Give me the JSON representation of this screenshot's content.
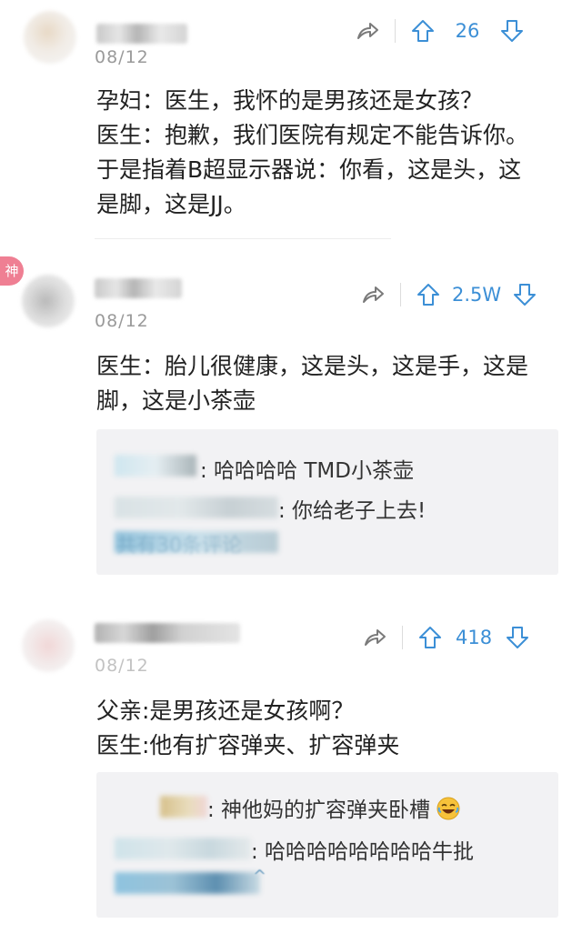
{
  "posts": [
    {
      "date": "08/12",
      "count": "26",
      "lines": [
        "孕妇：医生，我怀的是男孩还是女孩？",
        "医生：抱歉，我们医院有规定不能告诉你。",
        "于是指着B超显示器说：你看，这是头，这",
        "是脚，这是JJ。"
      ]
    },
    {
      "badge": "神",
      "date": "08/12",
      "count": "2.5W",
      "lines": [
        "医生：胎儿很健康，这是头，这是手，这是",
        "脚，这是小茶壶"
      ],
      "replies": [
        {
          "text": ": 哈哈哈哈 TMD小茶壶"
        },
        {
          "text": ": 你给老子上去!"
        }
      ],
      "more": "共有30条评论"
    },
    {
      "date": "08/12",
      "count": "418",
      "lines": [
        "父亲:是男孩还是女孩啊？",
        "医生:他有扩容弹夹、扩容弹夹"
      ],
      "replies": [
        {
          "text": ": 神他妈的扩容弹夹卧槽"
        },
        {
          "text": ": 哈哈哈哈哈哈哈哈牛批"
        }
      ]
    }
  ],
  "colors": {
    "accent": "#3c8fd6",
    "badge": "#ef7f93"
  }
}
